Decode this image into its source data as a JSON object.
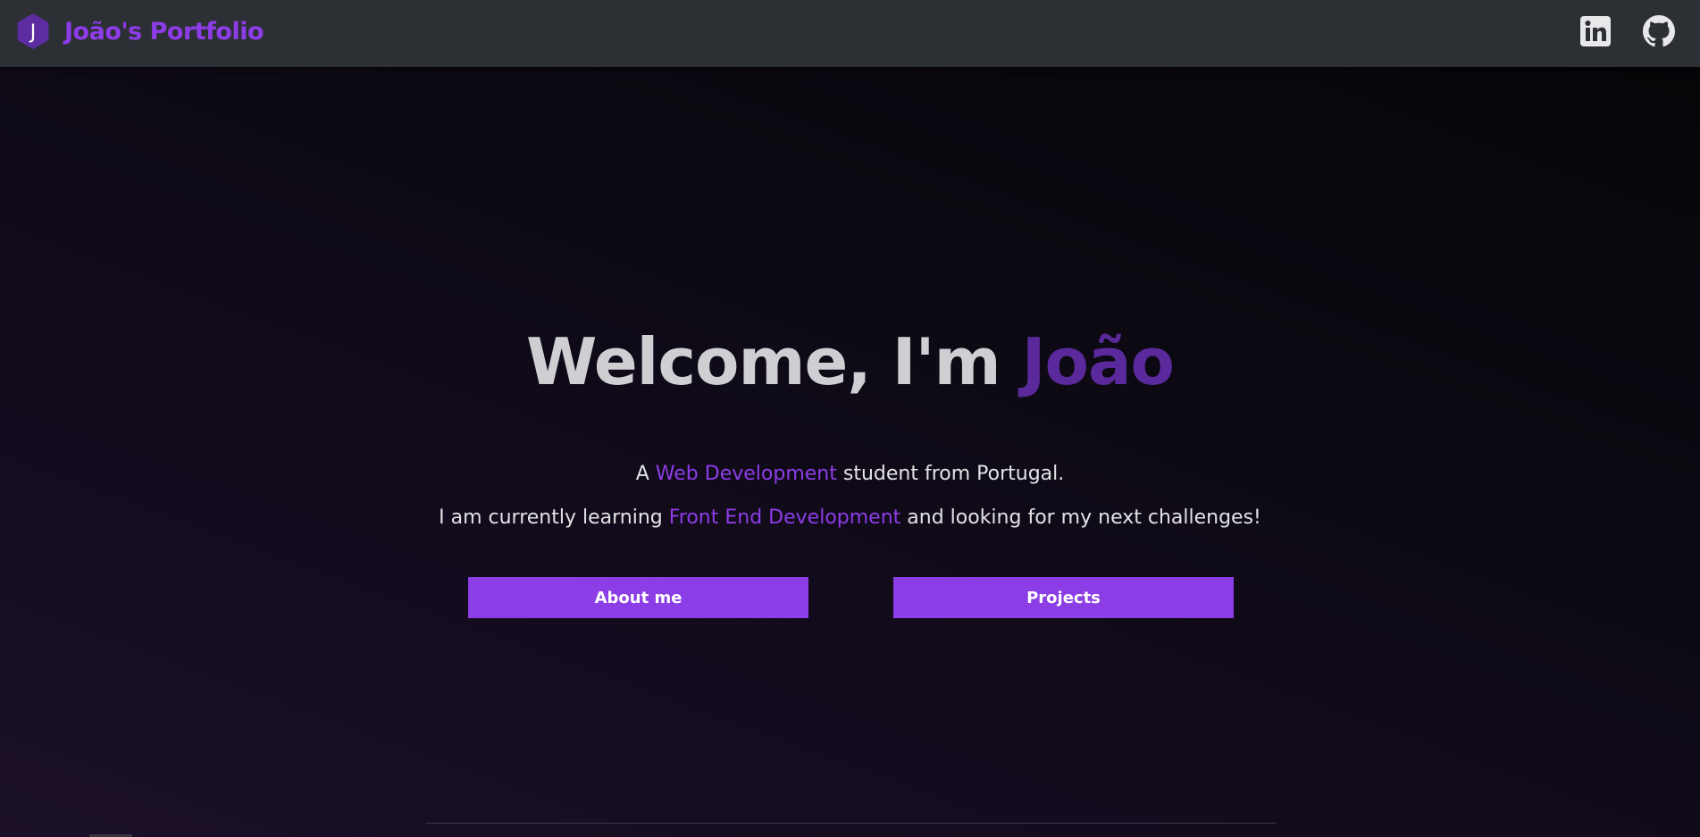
{
  "navbar": {
    "logo_letter": "J",
    "brand_name": "João's Portfolio",
    "social": {
      "linkedin_icon": "linkedin-icon",
      "github_icon": "github-icon"
    }
  },
  "hero": {
    "title_prefix": "Welcome, I'm ",
    "title_name": "João",
    "line1": {
      "before": "A ",
      "highlight": "Web Development",
      "after": " student from Portugal."
    },
    "line2": {
      "before": "I am currently learning ",
      "highlight": "Front End Development",
      "after": " and looking for my next challenges!"
    },
    "buttons": {
      "about": "About me",
      "projects": "Projects"
    }
  },
  "colors": {
    "accent": "#8d3ce8",
    "title_name": "#5a2a9c",
    "navbar_bg": "#2c3034",
    "button_bg": "#8b3ee6"
  }
}
